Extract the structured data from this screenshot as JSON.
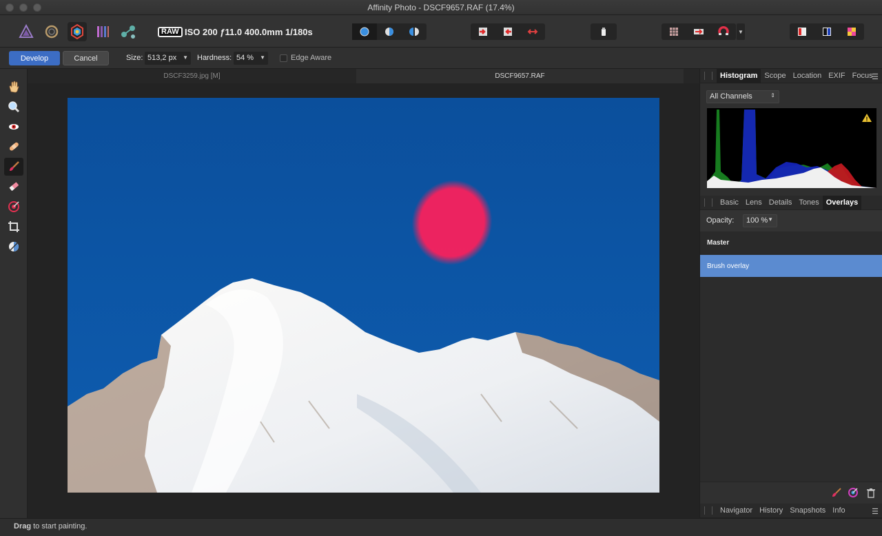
{
  "window": {
    "title": "Affinity Photo - DSCF9657.RAF (17.4%)"
  },
  "toolbar": {
    "personas": [
      "photo-persona-icon",
      "liquify-persona-icon",
      "develop-persona-icon",
      "tone-mapping-persona-icon",
      "export-persona-icon"
    ],
    "raw_badge": "RAW",
    "exif_summary": "ISO 200 ƒ11.0 400.0mm 1/180s"
  },
  "context": {
    "develop_label": "Develop",
    "cancel_label": "Cancel",
    "size_label": "Size:",
    "size_value": "513,2 px",
    "hardness_label": "Hardness:",
    "hardness_value": "54 %",
    "edge_aware_label": "Edge Aware"
  },
  "documents": {
    "tabs": [
      {
        "label": "DSCF3259.jpg [M]",
        "active": false
      },
      {
        "label": "DSCF9657.RAF",
        "active": true
      }
    ]
  },
  "histogram_panel": {
    "tabs": [
      "Histogram",
      "Scope",
      "Location",
      "EXIF",
      "Focus"
    ],
    "active_tab": "Histogram",
    "channel": "All Channels"
  },
  "adjust_panel": {
    "tabs": [
      "Basic",
      "Lens",
      "Details",
      "Tones",
      "Overlays"
    ],
    "active_tab": "Overlays",
    "opacity_label": "Opacity:",
    "opacity_value": "100 %",
    "overlays": [
      {
        "label": "Master",
        "selected": false
      },
      {
        "label": "Brush overlay",
        "selected": true
      }
    ]
  },
  "bottom_panel": {
    "tabs": [
      "Navigator",
      "History",
      "Snapshots",
      "Info"
    ]
  },
  "status": {
    "bold": "Drag",
    "rest": " to start painting."
  },
  "colors": {
    "accent": "#3c6dc4",
    "selection": "#5b8bd0",
    "overlay_mask": "#ff1f5a",
    "sky": "#0d56a4"
  }
}
